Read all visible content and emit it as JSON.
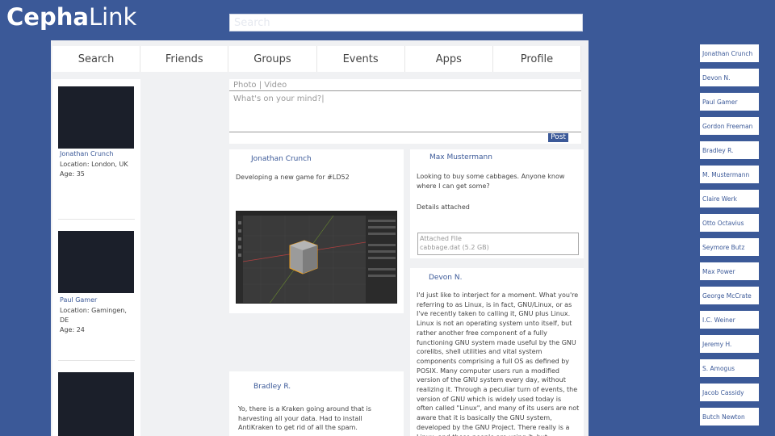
{
  "app": {
    "brand_bold": "Cepha",
    "brand_light": "Link"
  },
  "search": {
    "placeholder": "Search"
  },
  "nav": [
    "Search",
    "Friends",
    "Groups",
    "Events",
    "Apps",
    "Profile"
  ],
  "profiles": [
    {
      "name": "Jonathan Crunch",
      "location": "Location: London, UK",
      "age": "Age: 35"
    },
    {
      "name": "Paul Gamer",
      "location": "Location: Gamingen, DE",
      "age": "Age: 24"
    },
    {
      "name": "",
      "location": "",
      "age": ""
    }
  ],
  "composer": {
    "tabs": "Photo | Video",
    "placeholder": "What's on your mind?|",
    "post": "Post"
  },
  "posts": [
    {
      "author": "Jonathan Crunch",
      "text": "Developing a new game for #LD52"
    },
    {
      "author": "Max Mustermann",
      "text": "Looking to buy some cabbages. Anyone know where I can get some?",
      "text2": "Details attached",
      "attachment_label": "Attached File",
      "attachment_file": "cabbage.dat (5.2 GB)"
    },
    {
      "author": "Devon N.",
      "text": "I'd just like to interject for a moment. What you're referring to as Linux, is in fact, GNU/Linux, or as I've recently taken to calling it, GNU plus Linux. Linux is not an operating system unto itself, but rather another free component of a fully functioning GNU system made useful by the GNU corelibs, shell utilities and vital system components comprising a full OS as defined by POSIX. Many computer users run a modified version of the GNU system every day, without realizing it. Through a peculiar turn of events, the version of GNU which is widely used today is often called \"Linux\", and many of its users are not aware that it is basically the GNU system, developed by the GNU Project. There really is a Linux, and these people are using it, but"
    },
    {
      "author": "Bradley R.",
      "text": "Yo, there is a Kraken going around that is harvesting all your data. Had to install AntiKraken to get rid of all the spam."
    }
  ],
  "friends": [
    "Jonathan Crunch",
    "Devon N.",
    "Paul Gamer",
    "Gordon Freeman",
    "Bradley R.",
    "M. Mustermann",
    "Claire Werk",
    "Otto Octavius",
    "Seymore Butz",
    "Max Power",
    "George McCrate",
    "I.C. Weiner",
    "Jeremy H.",
    "S. Amogus",
    "Jacob Cassidy",
    "Butch Newton"
  ],
  "colors": {
    "brand": "#3b5998",
    "avatar": "#1b1f2a"
  }
}
